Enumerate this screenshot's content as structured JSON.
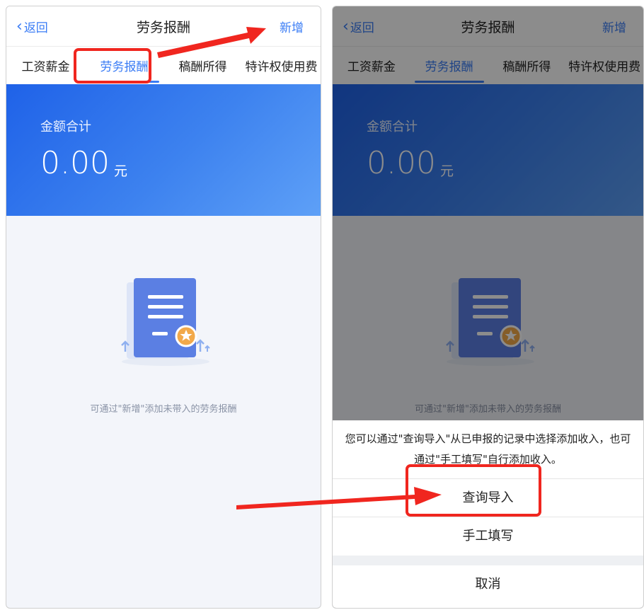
{
  "nav": {
    "back": "返回",
    "title": "劳务报酬",
    "add": "新增"
  },
  "tabs": [
    "工资薪金",
    "劳务报酬",
    "稿酬所得",
    "特许权使用费"
  ],
  "banner": {
    "label": "金额合计",
    "amount": "0.00",
    "unit": "元"
  },
  "empty": {
    "text": "可通过\"新增\"添加未带入的劳务报酬"
  },
  "sheet": {
    "message": "您可以通过\"查询导入\"从已申报的记录中选择添加收入，也可通过\"手工填写\"自行添加收入。",
    "options": [
      "查询导入",
      "手工填写"
    ],
    "cancel": "取消"
  },
  "colors": {
    "accent": "#3a7cf5",
    "banner_start": "#1f62e8",
    "banner_end": "#5ea0f7",
    "annotation": "#f0261f"
  }
}
